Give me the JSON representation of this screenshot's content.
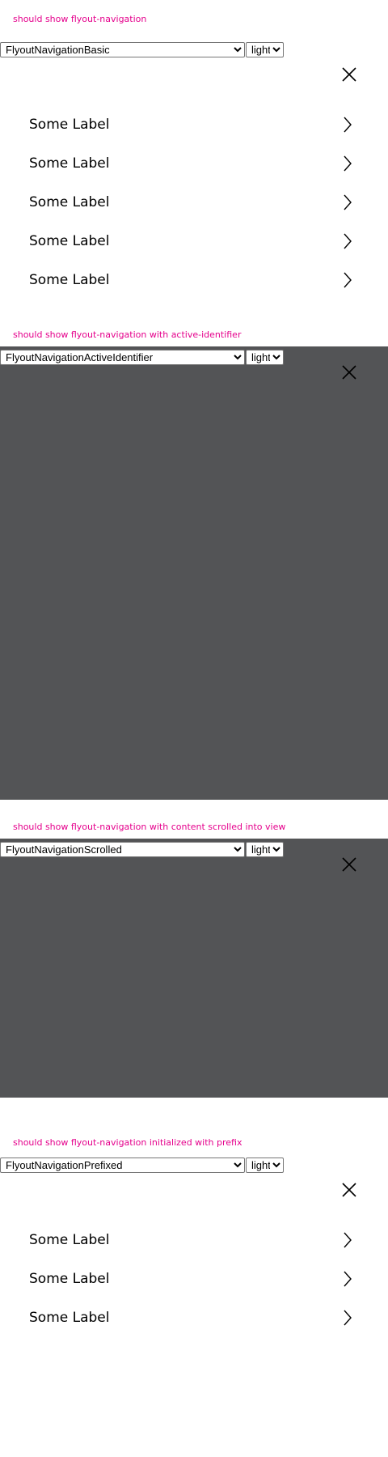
{
  "theme_options": [
    "light"
  ],
  "sections": [
    {
      "heading": "should show flyout-navigation",
      "story": "FlyoutNavigationBasic",
      "theme": "light",
      "items": [
        "Some Label",
        "Some Label",
        "Some Label",
        "Some Label",
        "Some Label"
      ]
    },
    {
      "heading": "should show flyout-navigation with active-identifier",
      "story": "FlyoutNavigationActiveIdentifier",
      "theme": "light",
      "items": []
    },
    {
      "heading": "should show flyout-navigation with content scrolled into view",
      "story": "FlyoutNavigationScrolled",
      "theme": "light",
      "items": []
    },
    {
      "heading": "should show flyout-navigation initialized with prefix",
      "story": "FlyoutNavigationPrefixed",
      "theme": "light",
      "items": [
        "Some Label",
        "Some Label",
        "Some Label"
      ]
    }
  ],
  "colors": {
    "heading_text": "#e5008c",
    "overlay_backdrop": "#535456",
    "page_background": "#ffffff"
  },
  "icons": {
    "close": "close-icon",
    "chevron": "chevron-right-icon"
  }
}
